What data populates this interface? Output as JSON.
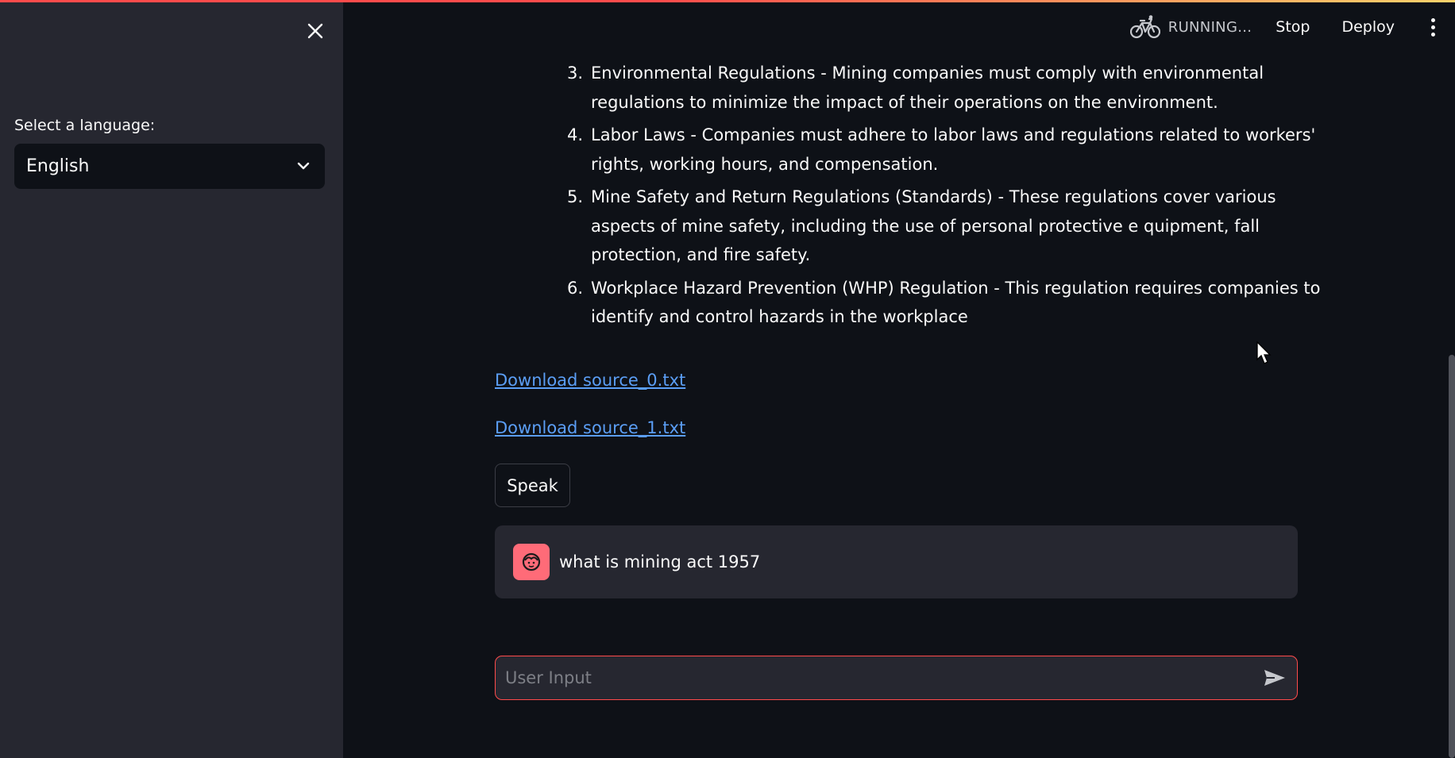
{
  "sidebar": {
    "language_label": "Select a language:",
    "language_selected": "English"
  },
  "header": {
    "status": "RUNNING...",
    "stop_label": "Stop",
    "deploy_label": "Deploy"
  },
  "regulations": [
    {
      "number": "3.",
      "text": "Environmental Regulations - Mining companies must comply with environmental regulations to minimize the impact of their operations on the environment."
    },
    {
      "number": "4.",
      "text": "Labor Laws - Companies must adhere to labor laws and regulations related to workers' rights, working hours, and compensation."
    },
    {
      "number": "5.",
      "text": "Mine Safety and Return Regulations (Standards) - These regulations cover various aspects of mine safety, including the use of personal protective e quipment, fall protection, and fire safety."
    },
    {
      "number": "6.",
      "text": "Workplace Hazard Prevention (WHP) Regulation - This regulation requires companies to identify and control hazards in the workplace"
    }
  ],
  "downloads": [
    "Download source_0.txt",
    "Download source_1.txt"
  ],
  "speak_label": "Speak",
  "chat": {
    "user_message": "what is mining act 1957"
  },
  "input": {
    "placeholder": "User Input",
    "value": ""
  },
  "colors": {
    "accent": "#ff4b4b",
    "link": "#5b9ef5",
    "avatar": "#ff6b78",
    "sidebar_bg": "#262730",
    "main_bg": "#0e1117"
  }
}
